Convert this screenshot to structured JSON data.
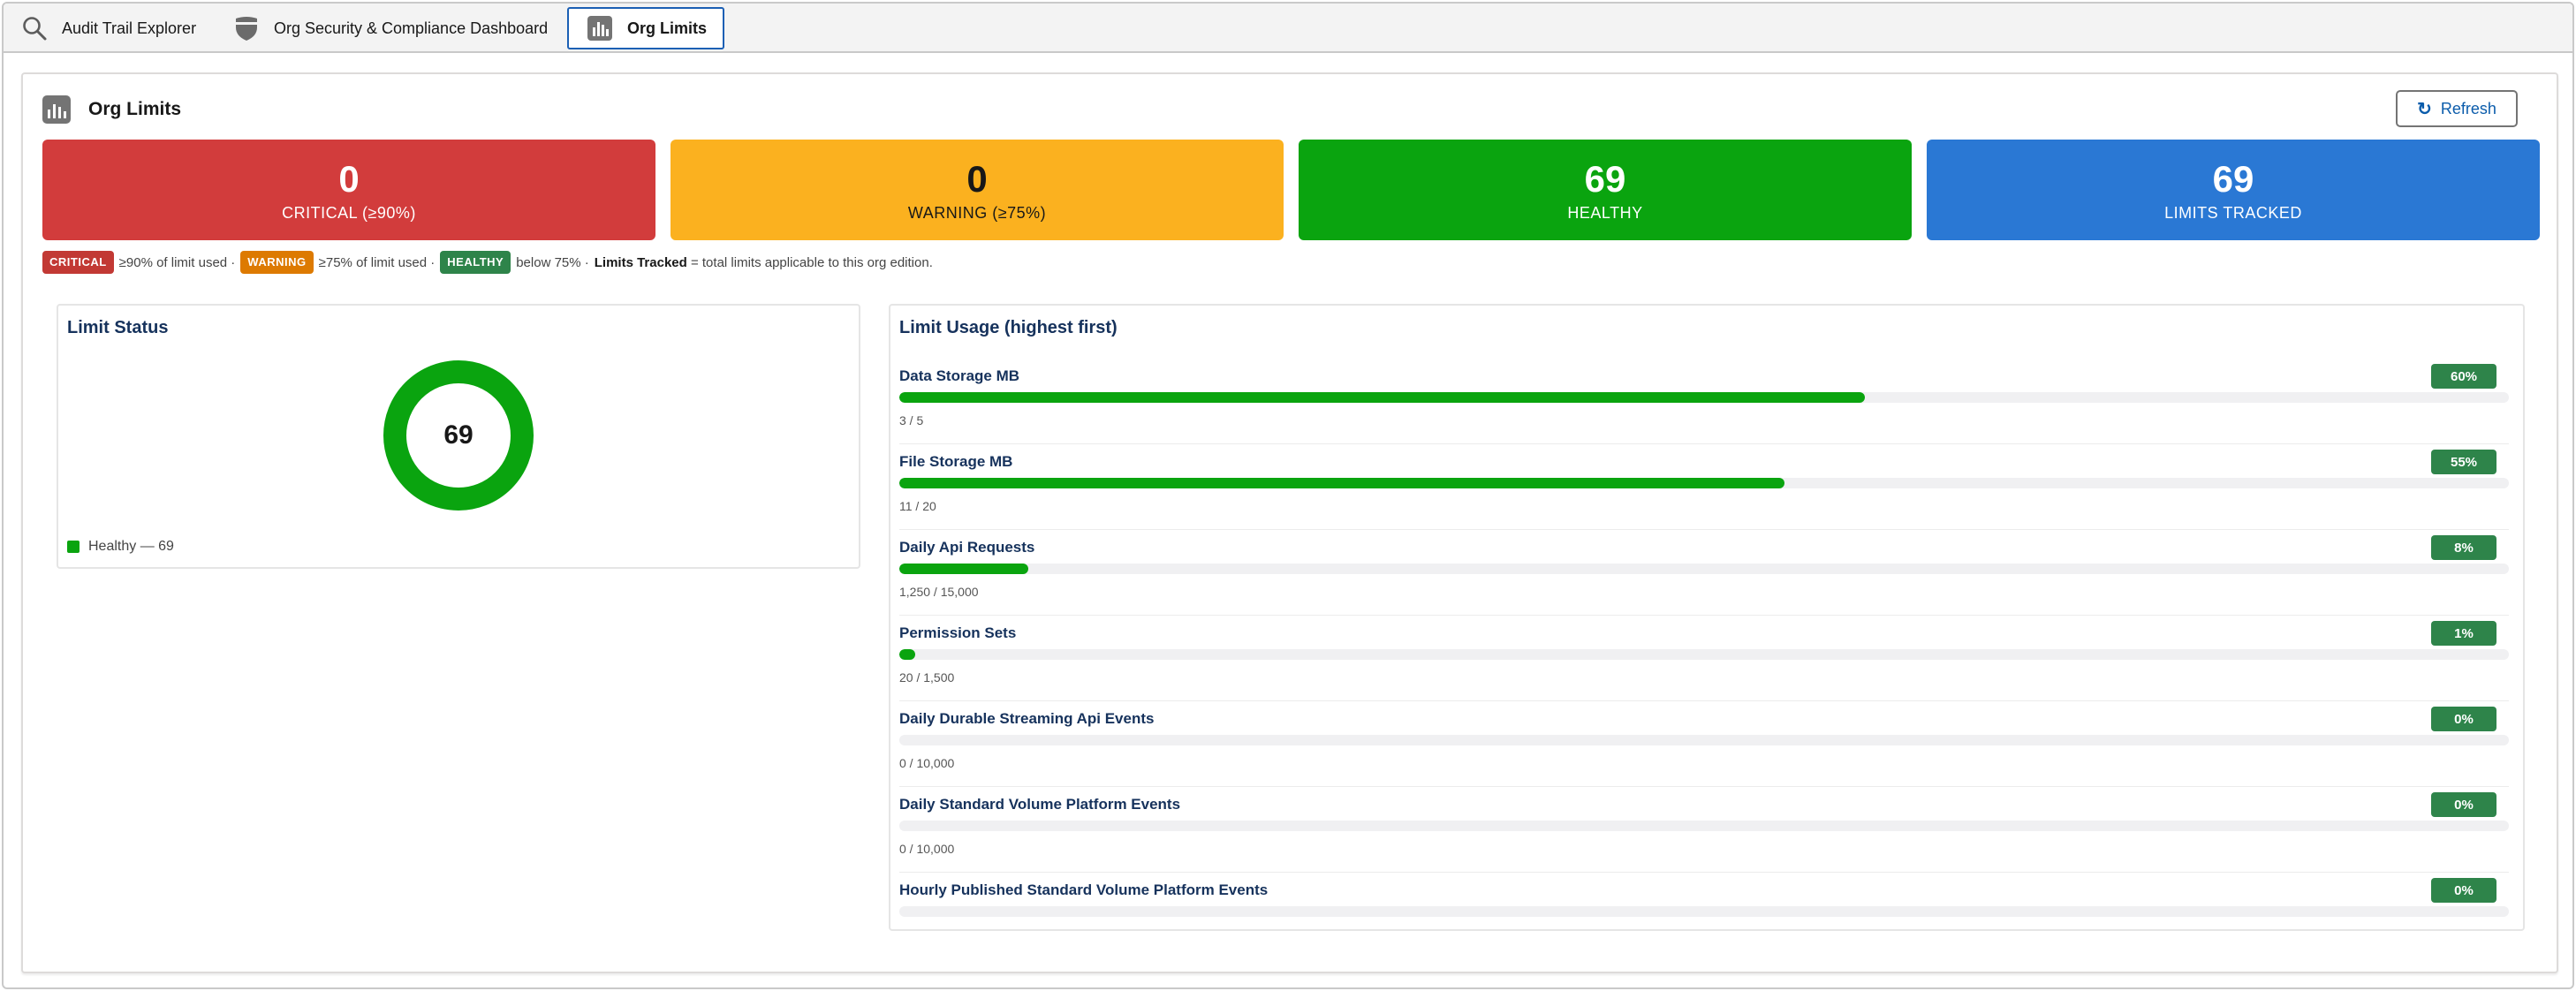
{
  "tabs": [
    {
      "label": "Audit Trail Explorer",
      "icon": "search-icon"
    },
    {
      "label": "Org Security & Compliance Dashboard",
      "icon": "shield-icon"
    },
    {
      "label": "Org Limits",
      "icon": "bar-chart-icon",
      "active": true
    }
  ],
  "card": {
    "title": "Org Limits",
    "refresh_label": "Refresh"
  },
  "tiles": {
    "critical": {
      "value": "0",
      "label": "CRITICAL (≥90%)",
      "color": "#d23c3c"
    },
    "warning": {
      "value": "0",
      "label": "WARNING (≥75%)",
      "color": "#fbb11f"
    },
    "healthy": {
      "value": "69",
      "label": "HEALTHY",
      "color": "#0aa40f"
    },
    "tracked": {
      "value": "69",
      "label": "LIMITS TRACKED",
      "color": "#2a78d4"
    }
  },
  "legend": {
    "critical_pill": "CRITICAL",
    "critical_text": "≥90% of limit used ·",
    "warning_pill": "WARNING",
    "warning_text": "≥75% of limit used ·",
    "healthy_pill": "HEALTHY",
    "healthy_text": "below 75% ·",
    "tracked_bold": "Limits Tracked",
    "tracked_text": " = total limits applicable to this org edition."
  },
  "status_panel": {
    "title": "Limit Status",
    "donut_center": "69",
    "legend_label": "Healthy — 69",
    "healthy_color": "#0aa40f"
  },
  "usage_panel": {
    "title": "Limit Usage (highest first)",
    "rows": [
      {
        "name": "Data Storage MB",
        "percent_label": "60%",
        "percent": 60,
        "count": "3 / 5"
      },
      {
        "name": "File Storage MB",
        "percent_label": "55%",
        "percent": 55,
        "count": "11 / 20"
      },
      {
        "name": "Daily Api Requests",
        "percent_label": "8%",
        "percent": 8,
        "count": "1,250 / 15,000"
      },
      {
        "name": "Permission Sets",
        "percent_label": "1%",
        "percent": 1,
        "count": "20 / 1,500"
      },
      {
        "name": "Daily Durable Streaming Api Events",
        "percent_label": "0%",
        "percent": 0,
        "count": "0 / 10,000"
      },
      {
        "name": "Daily Standard Volume Platform Events",
        "percent_label": "0%",
        "percent": 0,
        "count": "0 / 10,000"
      },
      {
        "name": "Hourly Published Standard Volume Platform Events",
        "percent_label": "0%",
        "percent": 0,
        "count": ""
      }
    ]
  }
}
